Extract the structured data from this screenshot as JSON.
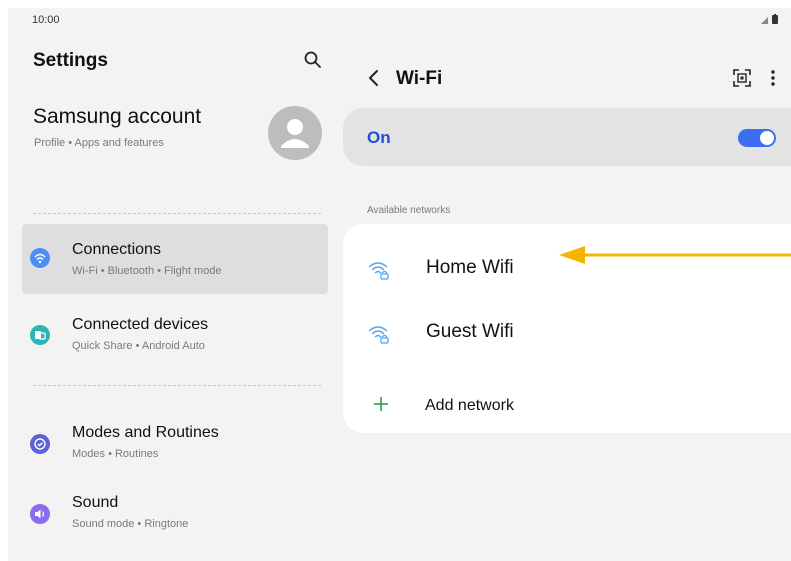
{
  "status_bar": {
    "time": "10:00"
  },
  "sidebar": {
    "title": "Settings",
    "account": {
      "name": "Samsung account",
      "subtitle": "Profile • Apps and features"
    },
    "items": [
      {
        "title": "Connections",
        "subtitle": "Wi-Fi • Bluetooth • Flight mode",
        "icon": "wifi-icon",
        "color": "#4f8ef7",
        "active": true
      },
      {
        "title": "Connected devices",
        "subtitle": "Quick Share • Android Auto",
        "icon": "devices-icon",
        "color": "#29b6b6"
      },
      {
        "title": "Modes and Routines",
        "subtitle": "Modes • Routines",
        "icon": "check-circle-icon",
        "color": "#5a62d6"
      },
      {
        "title": "Sound",
        "subtitle": "Sound mode • Ringtone",
        "icon": "speaker-icon",
        "color": "#8a6cf0"
      }
    ]
  },
  "wifi": {
    "title": "Wi-Fi",
    "toggle_label": "On",
    "toggle_state": true,
    "section_label": "Available networks",
    "networks": [
      {
        "name": "Home Wifi",
        "icon": "wifi-lock-icon"
      },
      {
        "name": "Guest Wifi",
        "icon": "wifi-lock-icon"
      }
    ],
    "add_network_label": "Add network"
  },
  "colors": {
    "accent": "#3b6ff0",
    "on_label": "#1f4fd6",
    "annotation_arrow": "#f4b400",
    "add_plus": "#2e9e4f"
  }
}
